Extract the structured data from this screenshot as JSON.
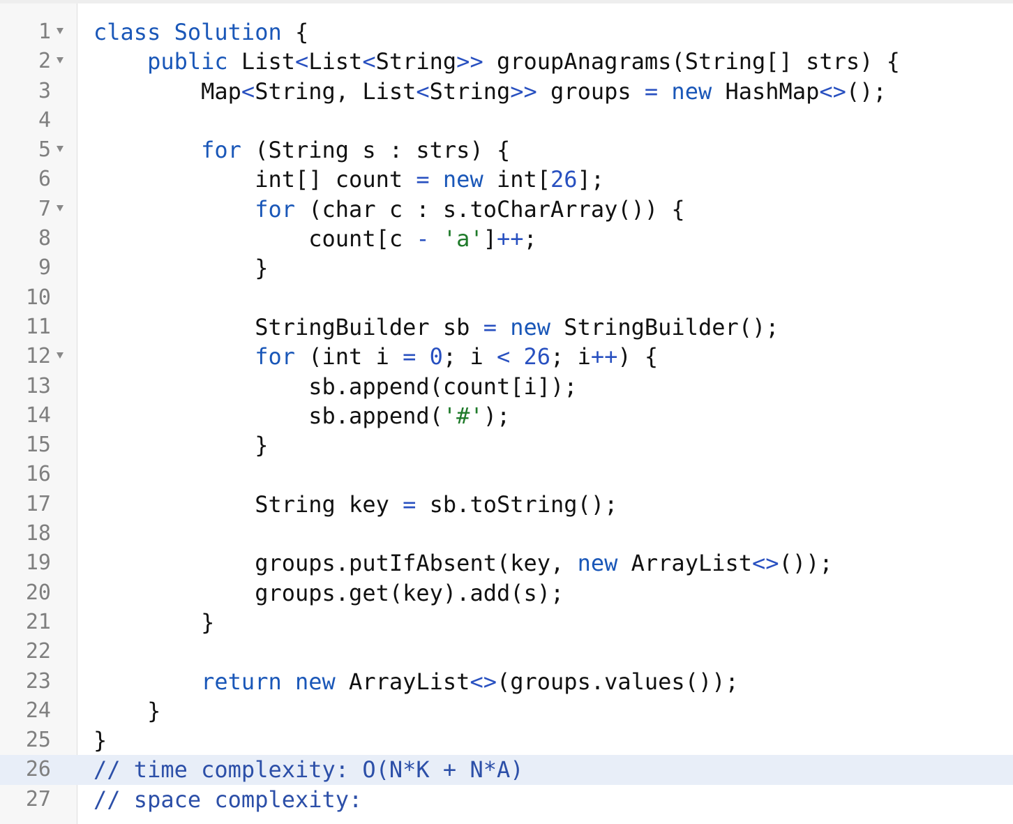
{
  "editor": {
    "colors": {
      "keyword": "#1a57b8",
      "number": "#2850c0",
      "string": "#1f7a2a",
      "comment": "#2c4fa8",
      "plain": "#111111",
      "line_number": "#7f7f7f",
      "active_line_bg": "#e8eef8"
    },
    "lines": [
      {
        "num": "1",
        "fold": true,
        "indent": 0,
        "tokens": [
          {
            "t": "keyword",
            "v": "class"
          },
          {
            "t": "plain",
            "v": " "
          },
          {
            "t": "keyword",
            "v": "Solution"
          },
          {
            "t": "plain",
            "v": " {"
          }
        ]
      },
      {
        "num": "2",
        "fold": true,
        "indent": 1,
        "tokens": [
          {
            "t": "keyword",
            "v": "public"
          },
          {
            "t": "plain",
            "v": " List"
          },
          {
            "t": "punct",
            "v": "<"
          },
          {
            "t": "plain",
            "v": "List"
          },
          {
            "t": "punct",
            "v": "<"
          },
          {
            "t": "plain",
            "v": "String"
          },
          {
            "t": "punct",
            "v": ">>"
          },
          {
            "t": "plain",
            "v": " groupAnagrams(String[] strs) {"
          }
        ]
      },
      {
        "num": "3",
        "fold": false,
        "indent": 2,
        "tokens": [
          {
            "t": "plain",
            "v": "Map"
          },
          {
            "t": "punct",
            "v": "<"
          },
          {
            "t": "plain",
            "v": "String, List"
          },
          {
            "t": "punct",
            "v": "<"
          },
          {
            "t": "plain",
            "v": "String"
          },
          {
            "t": "punct",
            "v": ">>"
          },
          {
            "t": "plain",
            "v": " groups "
          },
          {
            "t": "punct",
            "v": "="
          },
          {
            "t": "plain",
            "v": " "
          },
          {
            "t": "keyword",
            "v": "new"
          },
          {
            "t": "plain",
            "v": " HashMap"
          },
          {
            "t": "punct",
            "v": "<>"
          },
          {
            "t": "plain",
            "v": "();"
          }
        ]
      },
      {
        "num": "4",
        "fold": false,
        "indent": 0,
        "tokens": []
      },
      {
        "num": "5",
        "fold": true,
        "indent": 2,
        "tokens": [
          {
            "t": "keyword",
            "v": "for"
          },
          {
            "t": "plain",
            "v": " (String s : strs) {"
          }
        ]
      },
      {
        "num": "6",
        "fold": false,
        "indent": 3,
        "tokens": [
          {
            "t": "plain",
            "v": "int[] count "
          },
          {
            "t": "punct",
            "v": "="
          },
          {
            "t": "plain",
            "v": " "
          },
          {
            "t": "keyword",
            "v": "new"
          },
          {
            "t": "plain",
            "v": " int["
          },
          {
            "t": "number",
            "v": "26"
          },
          {
            "t": "plain",
            "v": "];"
          }
        ]
      },
      {
        "num": "7",
        "fold": true,
        "indent": 3,
        "tokens": [
          {
            "t": "keyword",
            "v": "for"
          },
          {
            "t": "plain",
            "v": " (char c : s.toCharArray()) {"
          }
        ]
      },
      {
        "num": "8",
        "fold": false,
        "indent": 4,
        "tokens": [
          {
            "t": "plain",
            "v": "count[c "
          },
          {
            "t": "punct",
            "v": "-"
          },
          {
            "t": "plain",
            "v": " "
          },
          {
            "t": "string",
            "v": "'a'"
          },
          {
            "t": "plain",
            "v": "]"
          },
          {
            "t": "punct",
            "v": "++"
          },
          {
            "t": "plain",
            "v": ";"
          }
        ]
      },
      {
        "num": "9",
        "fold": false,
        "indent": 3,
        "tokens": [
          {
            "t": "plain",
            "v": "}"
          }
        ]
      },
      {
        "num": "10",
        "fold": false,
        "indent": 0,
        "tokens": []
      },
      {
        "num": "11",
        "fold": false,
        "indent": 3,
        "tokens": [
          {
            "t": "plain",
            "v": "StringBuilder sb "
          },
          {
            "t": "punct",
            "v": "="
          },
          {
            "t": "plain",
            "v": " "
          },
          {
            "t": "keyword",
            "v": "new"
          },
          {
            "t": "plain",
            "v": " StringBuilder();"
          }
        ]
      },
      {
        "num": "12",
        "fold": true,
        "indent": 3,
        "tokens": [
          {
            "t": "keyword",
            "v": "for"
          },
          {
            "t": "plain",
            "v": " (int i "
          },
          {
            "t": "punct",
            "v": "="
          },
          {
            "t": "plain",
            "v": " "
          },
          {
            "t": "number",
            "v": "0"
          },
          {
            "t": "plain",
            "v": "; i "
          },
          {
            "t": "punct",
            "v": "<"
          },
          {
            "t": "plain",
            "v": " "
          },
          {
            "t": "number",
            "v": "26"
          },
          {
            "t": "plain",
            "v": "; i"
          },
          {
            "t": "punct",
            "v": "++"
          },
          {
            "t": "plain",
            "v": ") {"
          }
        ]
      },
      {
        "num": "13",
        "fold": false,
        "indent": 4,
        "tokens": [
          {
            "t": "plain",
            "v": "sb.append(count[i]);"
          }
        ]
      },
      {
        "num": "14",
        "fold": false,
        "indent": 4,
        "tokens": [
          {
            "t": "plain",
            "v": "sb.append("
          },
          {
            "t": "string",
            "v": "'#'"
          },
          {
            "t": "plain",
            "v": ");"
          }
        ]
      },
      {
        "num": "15",
        "fold": false,
        "indent": 3,
        "tokens": [
          {
            "t": "plain",
            "v": "}"
          }
        ]
      },
      {
        "num": "16",
        "fold": false,
        "indent": 0,
        "tokens": []
      },
      {
        "num": "17",
        "fold": false,
        "indent": 3,
        "tokens": [
          {
            "t": "plain",
            "v": "String key "
          },
          {
            "t": "punct",
            "v": "="
          },
          {
            "t": "plain",
            "v": " sb.toString();"
          }
        ]
      },
      {
        "num": "18",
        "fold": false,
        "indent": 0,
        "tokens": []
      },
      {
        "num": "19",
        "fold": false,
        "indent": 3,
        "tokens": [
          {
            "t": "plain",
            "v": "groups.putIfAbsent(key, "
          },
          {
            "t": "keyword",
            "v": "new"
          },
          {
            "t": "plain",
            "v": " ArrayList"
          },
          {
            "t": "punct",
            "v": "<>"
          },
          {
            "t": "plain",
            "v": "());"
          }
        ]
      },
      {
        "num": "20",
        "fold": false,
        "indent": 3,
        "tokens": [
          {
            "t": "plain",
            "v": "groups.get(key).add(s);"
          }
        ]
      },
      {
        "num": "21",
        "fold": false,
        "indent": 2,
        "tokens": [
          {
            "t": "plain",
            "v": "}"
          }
        ]
      },
      {
        "num": "22",
        "fold": false,
        "indent": 0,
        "tokens": []
      },
      {
        "num": "23",
        "fold": false,
        "indent": 2,
        "tokens": [
          {
            "t": "keyword",
            "v": "return"
          },
          {
            "t": "plain",
            "v": " "
          },
          {
            "t": "keyword",
            "v": "new"
          },
          {
            "t": "plain",
            "v": " ArrayList"
          },
          {
            "t": "punct",
            "v": "<>"
          },
          {
            "t": "plain",
            "v": "(groups.values());"
          }
        ]
      },
      {
        "num": "24",
        "fold": false,
        "indent": 1,
        "tokens": [
          {
            "t": "plain",
            "v": "}"
          }
        ]
      },
      {
        "num": "25",
        "fold": false,
        "indent": 0,
        "tokens": [
          {
            "t": "plain",
            "v": "}"
          }
        ]
      },
      {
        "num": "26",
        "fold": false,
        "indent": 0,
        "active": true,
        "tokens": [
          {
            "t": "comment",
            "v": "// time complexity: O(N*K + N*A)"
          }
        ]
      },
      {
        "num": "27",
        "fold": false,
        "indent": 0,
        "tokens": [
          {
            "t": "comment",
            "v": "// space complexity:"
          }
        ]
      }
    ]
  }
}
